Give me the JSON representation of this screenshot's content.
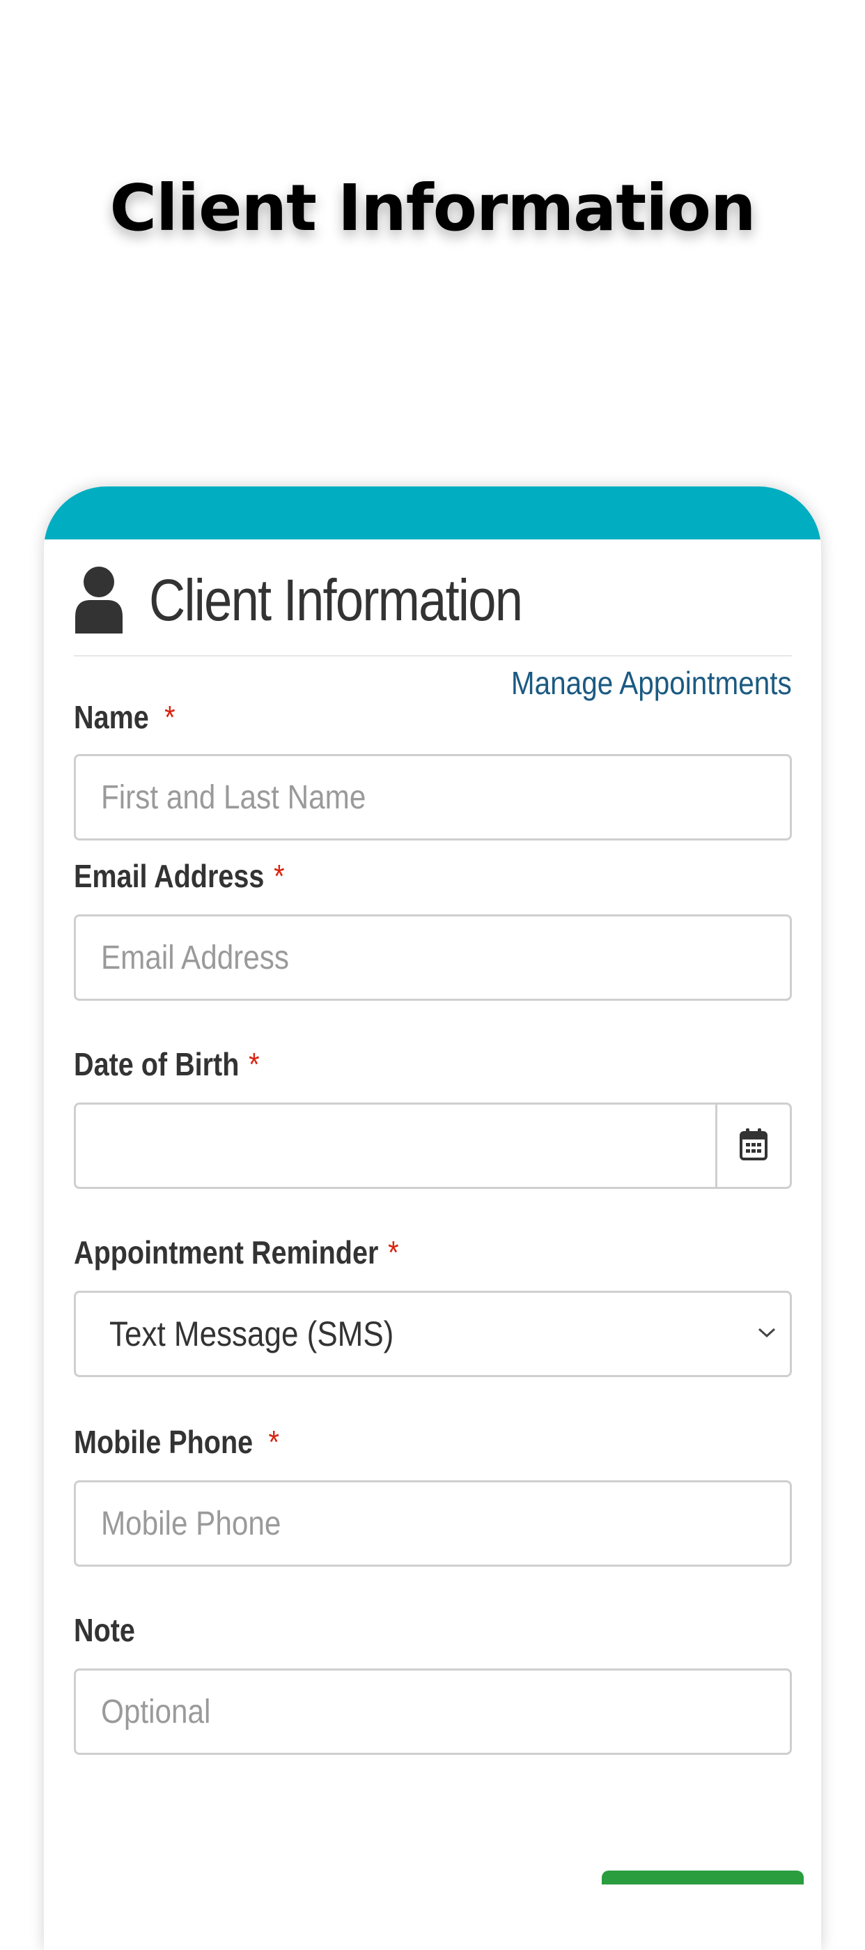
{
  "page": {
    "title": "Client Information"
  },
  "card": {
    "header_title": "Client Information",
    "manage_link": "Manage Appointments",
    "accent_color": "#00adc1",
    "icon": "user-icon"
  },
  "form": {
    "name": {
      "label": "Name",
      "required_mark": "*",
      "placeholder": "First and Last Name",
      "value": ""
    },
    "email": {
      "label": "Email Address",
      "required_mark": "*",
      "placeholder": "Email Address",
      "value": ""
    },
    "dob": {
      "label": "Date of Birth",
      "required_mark": "*",
      "value": "",
      "button_icon": "calendar-icon"
    },
    "reminder": {
      "label": "Appointment Reminder",
      "required_mark": "*",
      "selected": "Text Message (SMS)",
      "icon": "chevron-down-icon"
    },
    "mobile": {
      "label": "Mobile Phone",
      "required_mark": "*",
      "placeholder": "Mobile Phone",
      "value": ""
    },
    "note": {
      "label": "Note",
      "placeholder": "Optional",
      "value": ""
    }
  }
}
